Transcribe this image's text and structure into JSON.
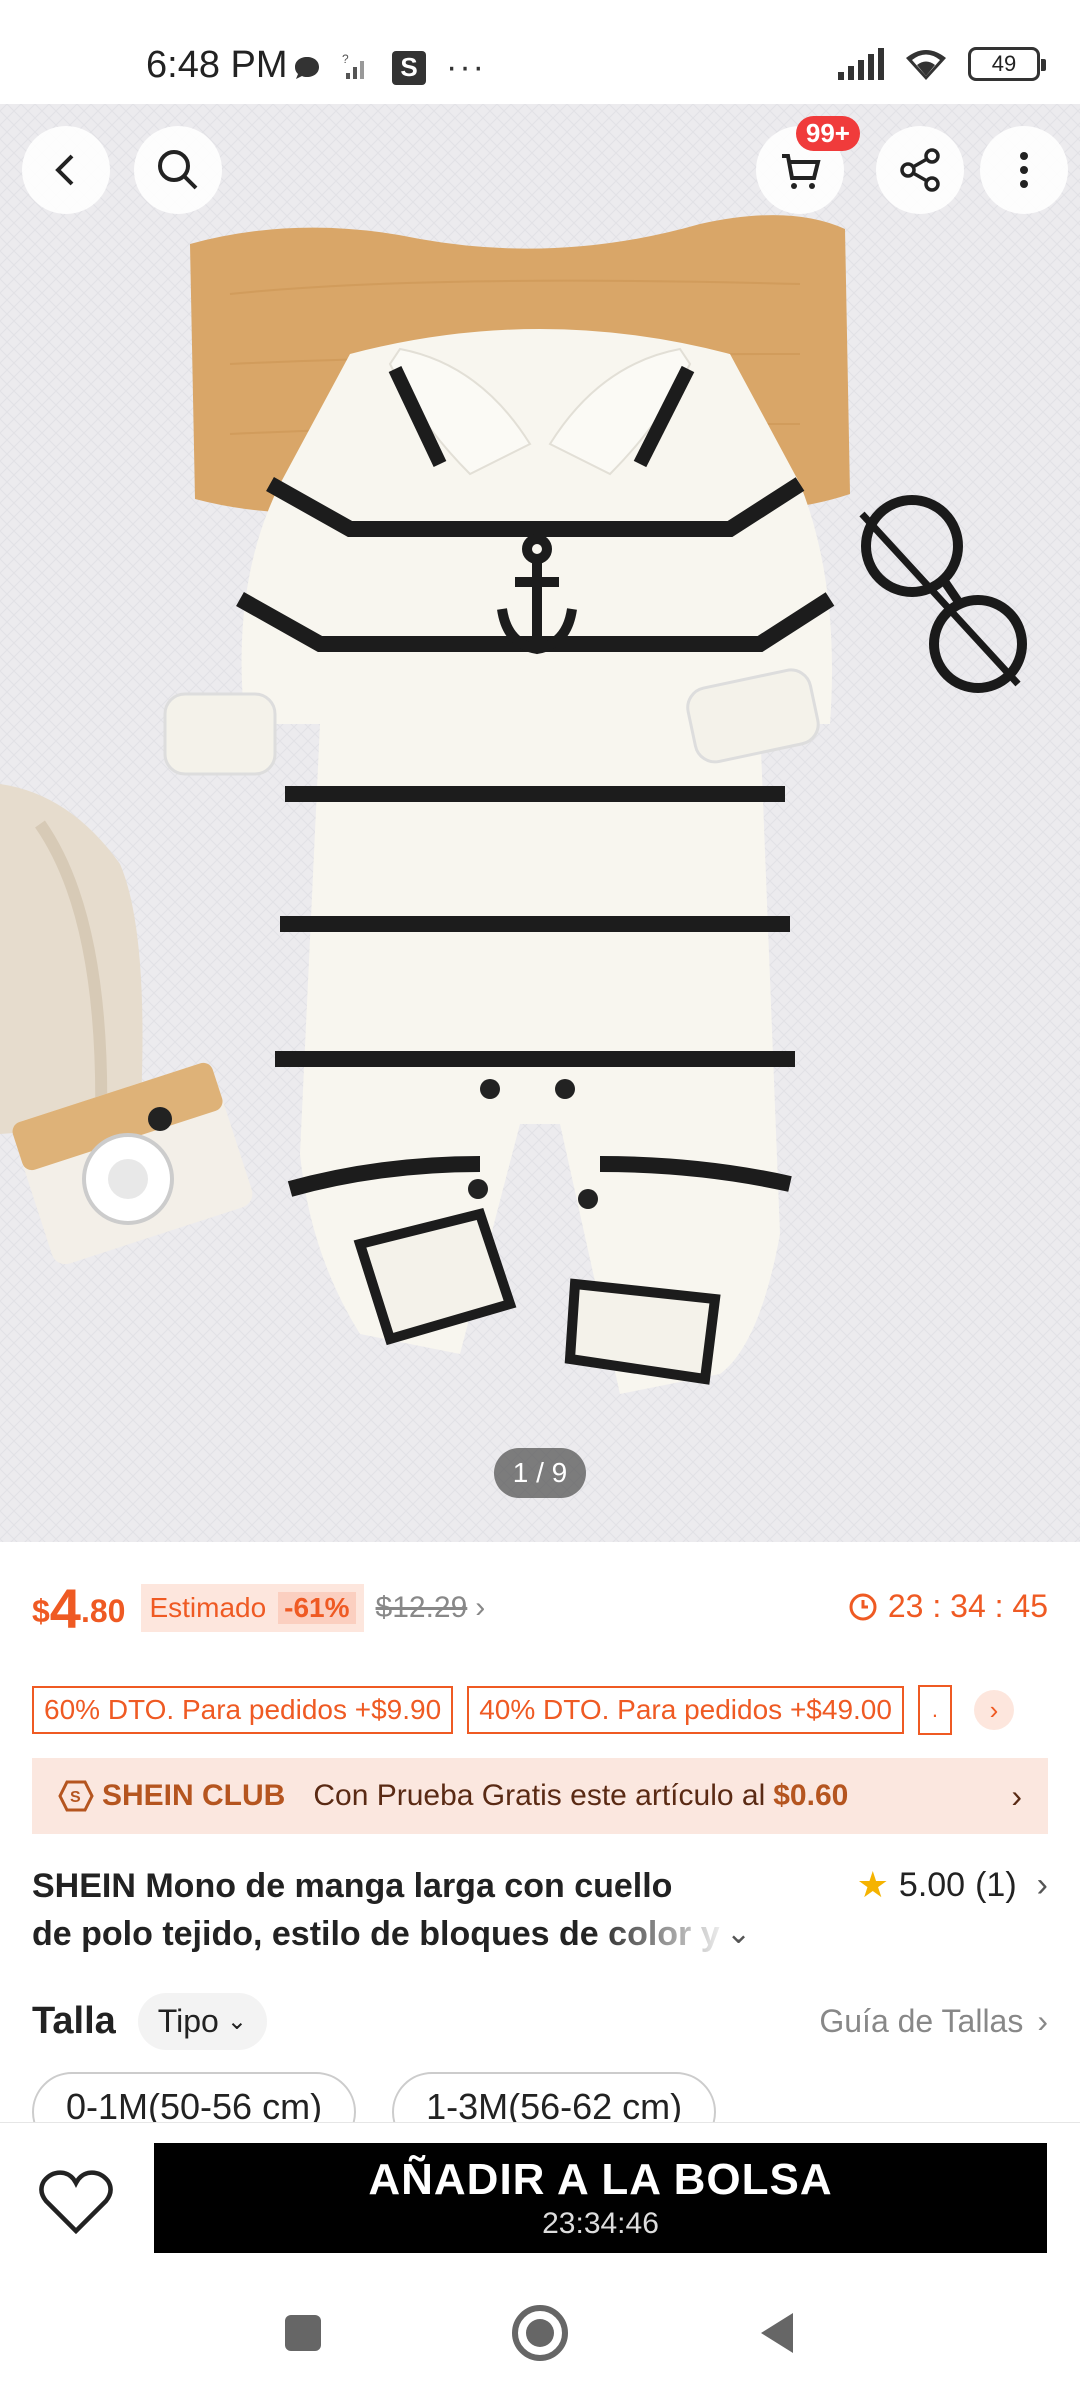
{
  "status_bar": {
    "time": "6:48 PM",
    "s_icon": "S",
    "dots": "···",
    "battery": "49"
  },
  "top_bar": {
    "cart_badge": "99+"
  },
  "gallery": {
    "counter": "1 / 9"
  },
  "price": {
    "currency": "$",
    "integer": "4",
    "decimal": ".80",
    "estimate_label": "Estimado",
    "discount": "-61%",
    "original": "$12.29",
    "timer": "23 : 34 : 45"
  },
  "promos": [
    "60% DTO. Para pedidos +$9.90",
    "40% DTO. Para pedidos +$49.00",
    "."
  ],
  "club": {
    "logo": "SHEIN CLUB",
    "text": "Con Prueba Gratis este artículo al",
    "price": "$0.60"
  },
  "product": {
    "title_line1": "SHEIN Mono de manga larga con cuello",
    "title_line2": "de polo tejido, estilo de bloques de color y",
    "rating": "5.00",
    "rating_count": "(1)"
  },
  "size": {
    "label": "Talla",
    "type_button": "Tipo",
    "guide": "Guía de Tallas",
    "options": [
      "0-1M(50-56 cm)",
      "1-3M(56-62 cm)"
    ]
  },
  "bottom": {
    "add_to_bag": "AÑADIR A LA BOLSA",
    "timer": "23:34:46"
  },
  "colors": {
    "accent": "#ef5a23",
    "club_bg": "#fbe7df",
    "cta_bg": "#000000"
  }
}
